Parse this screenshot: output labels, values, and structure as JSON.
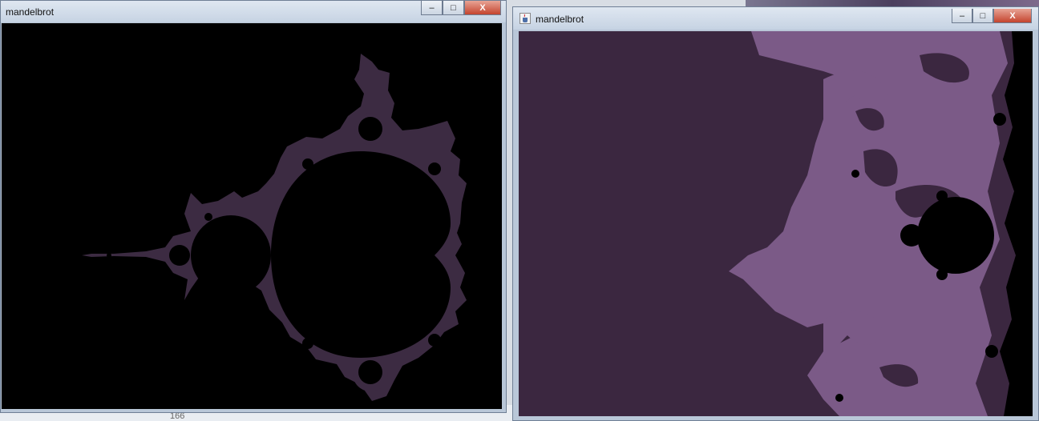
{
  "background_line_number": "166",
  "window_left": {
    "title": "mandelbrot",
    "buttons": {
      "minimize": "‒",
      "maximize": "□",
      "close": "X"
    }
  },
  "window_right": {
    "title": "mandelbrot",
    "buttons": {
      "minimize": "‒",
      "maximize": "□",
      "close": "X"
    }
  },
  "colors": {
    "left_canvas": "#000000",
    "fractal_edge": "#3c2b42",
    "right_canvas": "#3b2740",
    "right_detail": "#7b5a87",
    "window_border": "#b9c7d8"
  },
  "icons": {
    "app_icon": "java-cup-icon"
  }
}
